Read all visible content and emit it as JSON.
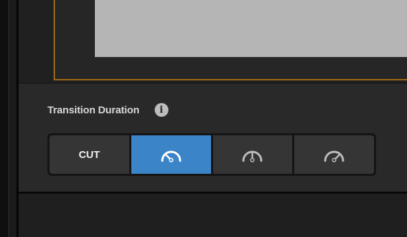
{
  "transition": {
    "label": "Transition Duration",
    "info_icon": "info-icon",
    "buttons": [
      {
        "label": "CUT",
        "icon": null,
        "active": false
      },
      {
        "label": "",
        "icon": "gauge-slow-icon",
        "active": true
      },
      {
        "label": "",
        "icon": "gauge-medium-icon",
        "active": false
      },
      {
        "label": "",
        "icon": "gauge-fast-icon",
        "active": false
      }
    ]
  },
  "colors": {
    "accent": "#3c84c8",
    "frame_border": "#a26a12",
    "panel": "#292929"
  }
}
